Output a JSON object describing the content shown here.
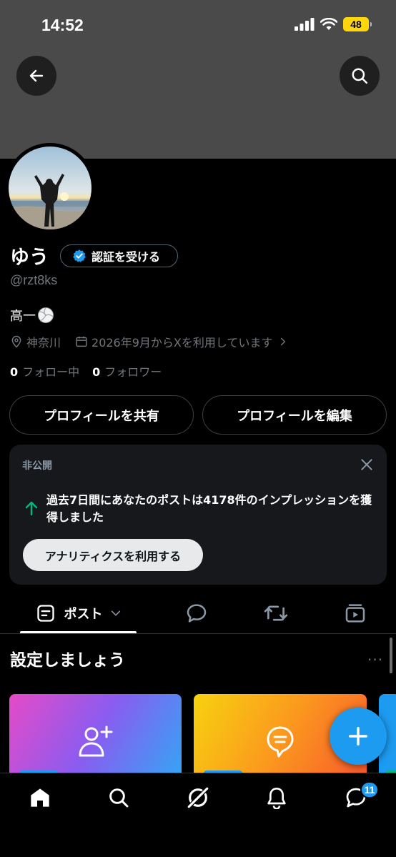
{
  "status_bar": {
    "time": "14:52",
    "battery": "48"
  },
  "profile": {
    "name": "ゆう",
    "verify_label": "認証を受ける",
    "handle": "@rzt8ks",
    "bio": "高一",
    "location": "神奈川",
    "joined": "2026年9月からXを利用しています",
    "following_count": "0",
    "following_label": "フォロー中",
    "followers_count": "0",
    "followers_label": "フォロワー"
  },
  "actions": {
    "share_label": "プロフィールを共有",
    "edit_label": "プロフィールを編集"
  },
  "private_card": {
    "label": "非公開",
    "message": "過去7日間にあなたのポストは4178件のインプレッションを獲得しました",
    "button_label": "アナリティクスを利用する"
  },
  "tabs": {
    "posts_label": "ポスト"
  },
  "setup": {
    "title": "設定しましょう",
    "more": "···"
  },
  "nav": {
    "messages_badge": "11"
  },
  "colors": {
    "accent": "#1d9bf0",
    "banner": "#4a4a4a",
    "up_arrow": "#00ba7c"
  },
  "icons": {
    "back": "arrow-left-icon",
    "search": "search-icon",
    "verified": "verified-badge-icon",
    "volleyball": "volleyball-icon",
    "location": "location-pin-icon",
    "calendar": "calendar-icon",
    "chevron": "chevron-right-icon",
    "close": "close-icon",
    "trend": "arrow-up-icon",
    "posts": "posts-tab-icon",
    "dropdown": "chevron-down-icon",
    "replies": "reply-bubble-icon",
    "reposts": "repost-icon",
    "media": "media-icon",
    "compose": "plus-icon",
    "home": "home-icon",
    "explore": "search-icon",
    "grok": "grok-icon",
    "notifications": "bell-icon",
    "messages": "messages-icon"
  }
}
